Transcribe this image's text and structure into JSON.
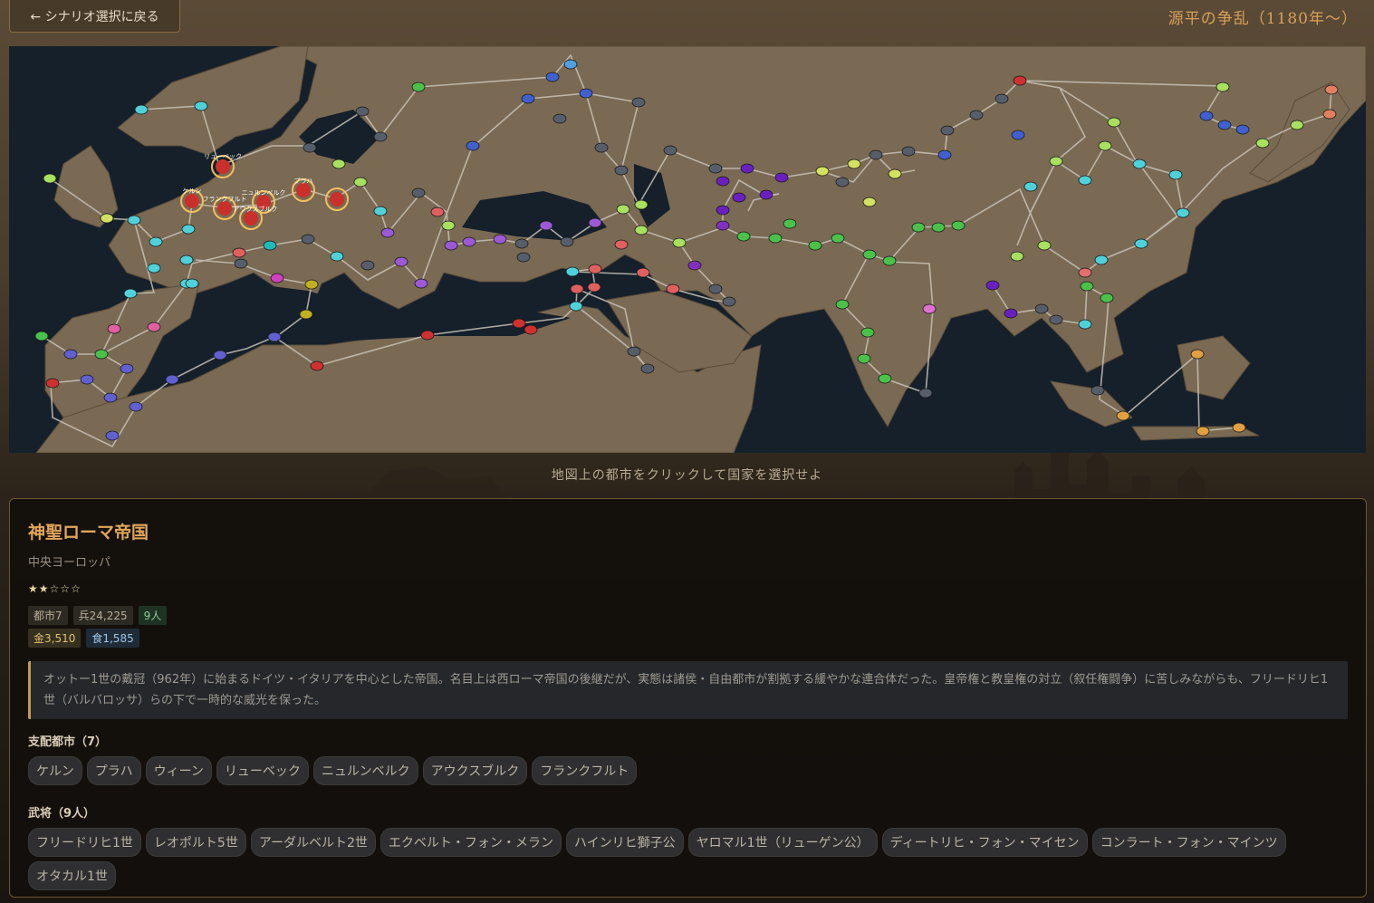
{
  "header": {
    "back_label": "← シナリオ選択に戻る",
    "scenario_title": "源平の争乱（1180年～）"
  },
  "map": {
    "hint": "地図上の都市をクリックして国家を選択せよ",
    "labels": {
      "lubeck": "リューベック",
      "koln": "ケルン",
      "frankfurt": "フランクフルト",
      "nurnberg": "ニュルンベルク",
      "augsburg": "アウクスブルク",
      "praha": "プラハ"
    },
    "colors": {
      "ocean": "#15202b",
      "land": "#7d6c55",
      "road": "#c8c2b6",
      "selected": "#c9302c",
      "highlight": "#f0c060"
    }
  },
  "nation": {
    "name": "神聖ローマ帝国",
    "region": "中央ヨーロッパ",
    "stars": "★★☆☆☆",
    "stats": {
      "cities": "都市7",
      "troops": "兵24,225",
      "generals_count": "9人",
      "gold": "金3,510",
      "food": "食1,585"
    },
    "description": "オットー1世の戴冠（962年）に始まるドイツ・イタリアを中心とした帝国。名目上は西ローマ帝国の後継だが、実態は諸侯・自由都市が割拠する緩やかな連合体だった。皇帝権と教皇権の対立（叙任権闘争）に苦しみながらも、フリードリヒ1世（バルバロッサ）らの下で一時的な威光を保った。",
    "cities_title": "支配都市（7）",
    "cities": [
      "ケルン",
      "プラハ",
      "ウィーン",
      "リューベック",
      "ニュルンベルク",
      "アウクスブルク",
      "フランクフルト"
    ],
    "generals_title": "武将（9人）",
    "generals": [
      "フリードリヒ1世",
      "レオポルト5世",
      "アーダルベルト2世",
      "エクベルト・フォン・メラン",
      "ハインリヒ獅子公",
      "ヤロマル1世（リューゲン公）",
      "ディートリヒ・フォン・マイセン",
      "コンラート・フォン・マインツ",
      "オタカル1世"
    ]
  }
}
